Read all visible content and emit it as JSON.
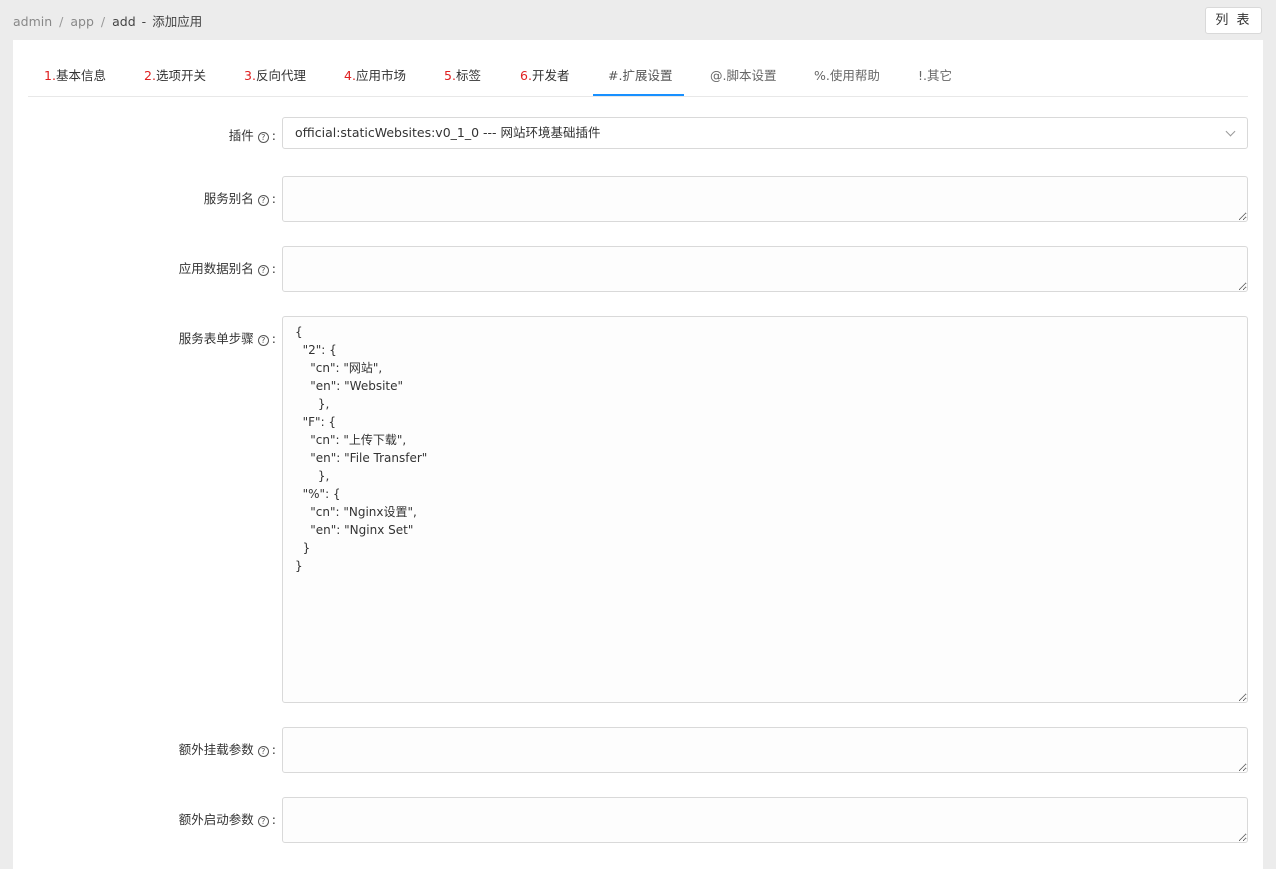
{
  "breadcrumb": {
    "items": [
      "admin",
      "app",
      "add"
    ],
    "separator": "/",
    "dash": "-",
    "page_title": "添加应用"
  },
  "header": {
    "list_button": "列 表"
  },
  "tabs": [
    {
      "num": "1.",
      "label": "基本信息"
    },
    {
      "num": "2.",
      "label": "选项开关"
    },
    {
      "num": "3.",
      "label": "反向代理"
    },
    {
      "num": "4.",
      "label": "应用市场"
    },
    {
      "num": "5.",
      "label": "标签"
    },
    {
      "num": "6.",
      "label": "开发者"
    },
    {
      "num": "",
      "label": "#.扩展设置"
    },
    {
      "num": "",
      "label": "@.脚本设置"
    },
    {
      "num": "",
      "label": "%.使用帮助"
    },
    {
      "num": "",
      "label": "!.其它"
    }
  ],
  "form": {
    "plugin": {
      "label": "插件",
      "value": "official:staticWebsites:v0_1_0 --- 网站环境基础插件"
    },
    "service_alias": {
      "label": "服务别名",
      "value": ""
    },
    "app_data_alias": {
      "label": "应用数据别名",
      "value": ""
    },
    "service_form_steps": {
      "label": "服务表单步骤",
      "value": "{\n  \"2\": {\n    \"cn\": \"网站\",\n    \"en\": \"Website\"\n      },\n  \"F\": {\n    \"cn\": \"上传下载\",\n    \"en\": \"File Transfer\"\n      },\n  \"%\": {\n    \"cn\": \"Nginx设置\",\n    \"en\": \"Nginx Set\"\n  }\n}"
    },
    "extra_mount_params": {
      "label": "额外挂载参数",
      "value": ""
    },
    "extra_start_params": {
      "label": "额外启动参数",
      "value": ""
    }
  },
  "colors": {
    "accent": "#1890ff",
    "tab_number": "#e02020"
  }
}
